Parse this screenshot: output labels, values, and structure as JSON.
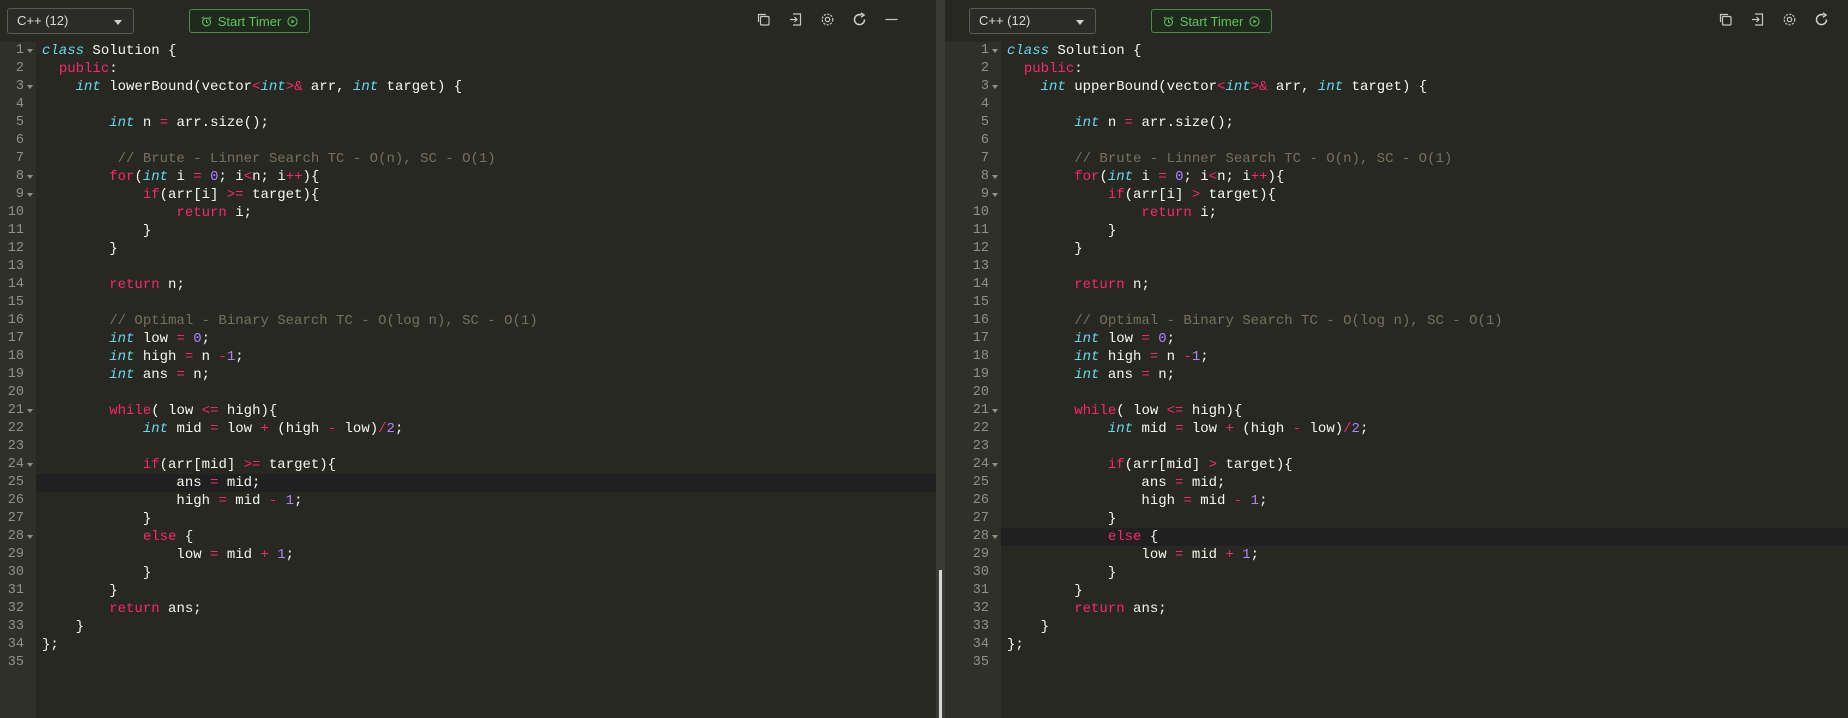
{
  "left": {
    "language": "C++ (12)",
    "timer_label": "Start Timer",
    "lines": [
      [
        [
          "st",
          "class"
        ],
        [
          "pl",
          " Solution {"
        ]
      ],
      [
        [
          "pl",
          "  "
        ],
        [
          "kw",
          "public"
        ],
        [
          "pl",
          ":"
        ]
      ],
      [
        [
          "pl",
          "    "
        ],
        [
          "ty",
          "int"
        ],
        [
          "pl",
          " lowerBound(vector"
        ],
        [
          "op",
          "<"
        ],
        [
          "ty",
          "int"
        ],
        [
          "op",
          ">&"
        ],
        [
          "pl",
          " arr, "
        ],
        [
          "ty",
          "int"
        ],
        [
          "pl",
          " target) {"
        ]
      ],
      [
        [
          "pl",
          ""
        ]
      ],
      [
        [
          "pl",
          "        "
        ],
        [
          "ty",
          "int"
        ],
        [
          "pl",
          " n "
        ],
        [
          "op",
          "="
        ],
        [
          "pl",
          " arr.size();"
        ]
      ],
      [
        [
          "pl",
          ""
        ]
      ],
      [
        [
          "pl",
          "         "
        ],
        [
          "cm",
          "// Brute - Linner Search TC - O(n), SC - O(1)"
        ]
      ],
      [
        [
          "pl",
          "        "
        ],
        [
          "kw",
          "for"
        ],
        [
          "pl",
          "("
        ],
        [
          "ty",
          "int"
        ],
        [
          "pl",
          " i "
        ],
        [
          "op",
          "="
        ],
        [
          "pl",
          " "
        ],
        [
          "num",
          "0"
        ],
        [
          "pl",
          "; i"
        ],
        [
          "op",
          "<"
        ],
        [
          "pl",
          "n; i"
        ],
        [
          "op",
          "++"
        ],
        [
          "pl",
          "){"
        ]
      ],
      [
        [
          "pl",
          "            "
        ],
        [
          "kw",
          "if"
        ],
        [
          "pl",
          "(arr[i] "
        ],
        [
          "op",
          ">="
        ],
        [
          "pl",
          " target){"
        ]
      ],
      [
        [
          "pl",
          "                "
        ],
        [
          "kw",
          "return"
        ],
        [
          "pl",
          " i;"
        ]
      ],
      [
        [
          "pl",
          "            }"
        ]
      ],
      [
        [
          "pl",
          "        }"
        ]
      ],
      [
        [
          "pl",
          ""
        ]
      ],
      [
        [
          "pl",
          "        "
        ],
        [
          "kw",
          "return"
        ],
        [
          "pl",
          " n;"
        ]
      ],
      [
        [
          "pl",
          ""
        ]
      ],
      [
        [
          "pl",
          "        "
        ],
        [
          "cm",
          "// Optimal - Binary Search TC - O(log n), SC - O(1)"
        ]
      ],
      [
        [
          "pl",
          "        "
        ],
        [
          "ty",
          "int"
        ],
        [
          "pl",
          " low "
        ],
        [
          "op",
          "="
        ],
        [
          "pl",
          " "
        ],
        [
          "num",
          "0"
        ],
        [
          "pl",
          ";"
        ]
      ],
      [
        [
          "pl",
          "        "
        ],
        [
          "ty",
          "int"
        ],
        [
          "pl",
          " high "
        ],
        [
          "op",
          "="
        ],
        [
          "pl",
          " n "
        ],
        [
          "op",
          "-"
        ],
        [
          "num",
          "1"
        ],
        [
          "pl",
          ";"
        ]
      ],
      [
        [
          "pl",
          "        "
        ],
        [
          "ty",
          "int"
        ],
        [
          "pl",
          " ans "
        ],
        [
          "op",
          "="
        ],
        [
          "pl",
          " n;"
        ]
      ],
      [
        [
          "pl",
          ""
        ]
      ],
      [
        [
          "pl",
          "        "
        ],
        [
          "kw",
          "while"
        ],
        [
          "pl",
          "( low "
        ],
        [
          "op",
          "<="
        ],
        [
          "pl",
          " high){"
        ]
      ],
      [
        [
          "pl",
          "            "
        ],
        [
          "ty",
          "int"
        ],
        [
          "pl",
          " mid "
        ],
        [
          "op",
          "="
        ],
        [
          "pl",
          " low "
        ],
        [
          "op",
          "+"
        ],
        [
          "pl",
          " (high "
        ],
        [
          "op",
          "-"
        ],
        [
          "pl",
          " low)"
        ],
        [
          "op",
          "/"
        ],
        [
          "num",
          "2"
        ],
        [
          "pl",
          ";"
        ]
      ],
      [
        [
          "pl",
          ""
        ]
      ],
      [
        [
          "pl",
          "            "
        ],
        [
          "kw",
          "if"
        ],
        [
          "pl",
          "(arr[mid] "
        ],
        [
          "op",
          ">="
        ],
        [
          "pl",
          " target){"
        ]
      ],
      [
        [
          "pl",
          "                ans "
        ],
        [
          "op",
          "="
        ],
        [
          "pl",
          " mid;"
        ]
      ],
      [
        [
          "pl",
          "                high "
        ],
        [
          "op",
          "="
        ],
        [
          "pl",
          " mid "
        ],
        [
          "op",
          "-"
        ],
        [
          "pl",
          " "
        ],
        [
          "num",
          "1"
        ],
        [
          "pl",
          ";"
        ]
      ],
      [
        [
          "pl",
          "            }"
        ]
      ],
      [
        [
          "pl",
          "            "
        ],
        [
          "kw",
          "else"
        ],
        [
          "pl",
          " {"
        ]
      ],
      [
        [
          "pl",
          "                low "
        ],
        [
          "op",
          "="
        ],
        [
          "pl",
          " mid "
        ],
        [
          "op",
          "+"
        ],
        [
          "pl",
          " "
        ],
        [
          "num",
          "1"
        ],
        [
          "pl",
          ";"
        ]
      ],
      [
        [
          "pl",
          "            }"
        ]
      ],
      [
        [
          "pl",
          "        }"
        ]
      ],
      [
        [
          "pl",
          "        "
        ],
        [
          "kw",
          "return"
        ],
        [
          "pl",
          " ans;"
        ]
      ],
      [
        [
          "pl",
          "    }"
        ]
      ],
      [
        [
          "pl",
          "};"
        ]
      ],
      [
        [
          "pl",
          ""
        ]
      ]
    ],
    "fold_lines": [
      1,
      3,
      8,
      9,
      21,
      24,
      28
    ],
    "active_line": 25
  },
  "right": {
    "language": "C++ (12)",
    "timer_label": "Start Timer",
    "lines": [
      [
        [
          "st",
          "class"
        ],
        [
          "pl",
          " Solution {"
        ]
      ],
      [
        [
          "pl",
          "  "
        ],
        [
          "kw",
          "public"
        ],
        [
          "pl",
          ":"
        ]
      ],
      [
        [
          "pl",
          "    "
        ],
        [
          "ty",
          "int"
        ],
        [
          "pl",
          " upperBound(vector"
        ],
        [
          "op",
          "<"
        ],
        [
          "ty",
          "int"
        ],
        [
          "op",
          ">&"
        ],
        [
          "pl",
          " arr, "
        ],
        [
          "ty",
          "int"
        ],
        [
          "pl",
          " target) {"
        ]
      ],
      [
        [
          "pl",
          ""
        ]
      ],
      [
        [
          "pl",
          "        "
        ],
        [
          "ty",
          "int"
        ],
        [
          "pl",
          " n "
        ],
        [
          "op",
          "="
        ],
        [
          "pl",
          " arr.size();"
        ]
      ],
      [
        [
          "pl",
          ""
        ]
      ],
      [
        [
          "pl",
          "        "
        ],
        [
          "cm",
          "// Brute - Linner Search TC - O(n), SC - O(1)"
        ]
      ],
      [
        [
          "pl",
          "        "
        ],
        [
          "kw",
          "for"
        ],
        [
          "pl",
          "("
        ],
        [
          "ty",
          "int"
        ],
        [
          "pl",
          " i "
        ],
        [
          "op",
          "="
        ],
        [
          "pl",
          " "
        ],
        [
          "num",
          "0"
        ],
        [
          "pl",
          "; i"
        ],
        [
          "op",
          "<"
        ],
        [
          "pl",
          "n; i"
        ],
        [
          "op",
          "++"
        ],
        [
          "pl",
          "){"
        ]
      ],
      [
        [
          "pl",
          "            "
        ],
        [
          "kw",
          "if"
        ],
        [
          "pl",
          "(arr[i] "
        ],
        [
          "op",
          ">"
        ],
        [
          "pl",
          " target){"
        ]
      ],
      [
        [
          "pl",
          "                "
        ],
        [
          "kw",
          "return"
        ],
        [
          "pl",
          " i;"
        ]
      ],
      [
        [
          "pl",
          "            }"
        ]
      ],
      [
        [
          "pl",
          "        }"
        ]
      ],
      [
        [
          "pl",
          ""
        ]
      ],
      [
        [
          "pl",
          "        "
        ],
        [
          "kw",
          "return"
        ],
        [
          "pl",
          " n;"
        ]
      ],
      [
        [
          "pl",
          ""
        ]
      ],
      [
        [
          "pl",
          "        "
        ],
        [
          "cm",
          "// Optimal - Binary Search TC - O(log n), SC - O(1)"
        ]
      ],
      [
        [
          "pl",
          "        "
        ],
        [
          "ty",
          "int"
        ],
        [
          "pl",
          " low "
        ],
        [
          "op",
          "="
        ],
        [
          "pl",
          " "
        ],
        [
          "num",
          "0"
        ],
        [
          "pl",
          ";"
        ]
      ],
      [
        [
          "pl",
          "        "
        ],
        [
          "ty",
          "int"
        ],
        [
          "pl",
          " high "
        ],
        [
          "op",
          "="
        ],
        [
          "pl",
          " n "
        ],
        [
          "op",
          "-"
        ],
        [
          "num",
          "1"
        ],
        [
          "pl",
          ";"
        ]
      ],
      [
        [
          "pl",
          "        "
        ],
        [
          "ty",
          "int"
        ],
        [
          "pl",
          " ans "
        ],
        [
          "op",
          "="
        ],
        [
          "pl",
          " n;"
        ]
      ],
      [
        [
          "pl",
          ""
        ]
      ],
      [
        [
          "pl",
          "        "
        ],
        [
          "kw",
          "while"
        ],
        [
          "pl",
          "( low "
        ],
        [
          "op",
          "<="
        ],
        [
          "pl",
          " high){"
        ]
      ],
      [
        [
          "pl",
          "            "
        ],
        [
          "ty",
          "int"
        ],
        [
          "pl",
          " mid "
        ],
        [
          "op",
          "="
        ],
        [
          "pl",
          " low "
        ],
        [
          "op",
          "+"
        ],
        [
          "pl",
          " (high "
        ],
        [
          "op",
          "-"
        ],
        [
          "pl",
          " low)"
        ],
        [
          "op",
          "/"
        ],
        [
          "num",
          "2"
        ],
        [
          "pl",
          ";"
        ]
      ],
      [
        [
          "pl",
          ""
        ]
      ],
      [
        [
          "pl",
          "            "
        ],
        [
          "kw",
          "if"
        ],
        [
          "pl",
          "(arr[mid] "
        ],
        [
          "op",
          ">"
        ],
        [
          "pl",
          " target){"
        ]
      ],
      [
        [
          "pl",
          "                ans "
        ],
        [
          "op",
          "="
        ],
        [
          "pl",
          " mid;"
        ]
      ],
      [
        [
          "pl",
          "                high "
        ],
        [
          "op",
          "="
        ],
        [
          "pl",
          " mid "
        ],
        [
          "op",
          "-"
        ],
        [
          "pl",
          " "
        ],
        [
          "num",
          "1"
        ],
        [
          "pl",
          ";"
        ]
      ],
      [
        [
          "pl",
          "            }"
        ]
      ],
      [
        [
          "pl",
          "            "
        ],
        [
          "kw",
          "else"
        ],
        [
          "pl",
          " {"
        ]
      ],
      [
        [
          "pl",
          "                low "
        ],
        [
          "op",
          "="
        ],
        [
          "pl",
          " mid "
        ],
        [
          "op",
          "+"
        ],
        [
          "pl",
          " "
        ],
        [
          "num",
          "1"
        ],
        [
          "pl",
          ";"
        ]
      ],
      [
        [
          "pl",
          "            }"
        ]
      ],
      [
        [
          "pl",
          "        }"
        ]
      ],
      [
        [
          "pl",
          "        "
        ],
        [
          "kw",
          "return"
        ],
        [
          "pl",
          " ans;"
        ]
      ],
      [
        [
          "pl",
          "    }"
        ]
      ],
      [
        [
          "pl",
          "};"
        ]
      ],
      [
        [
          "pl",
          ""
        ]
      ]
    ],
    "fold_lines": [
      1,
      3,
      8,
      9,
      21,
      24,
      28
    ],
    "active_line": 28
  },
  "icons": [
    "copy-icon",
    "import-icon",
    "settings-icon",
    "reset-icon",
    "minimize-icon"
  ]
}
